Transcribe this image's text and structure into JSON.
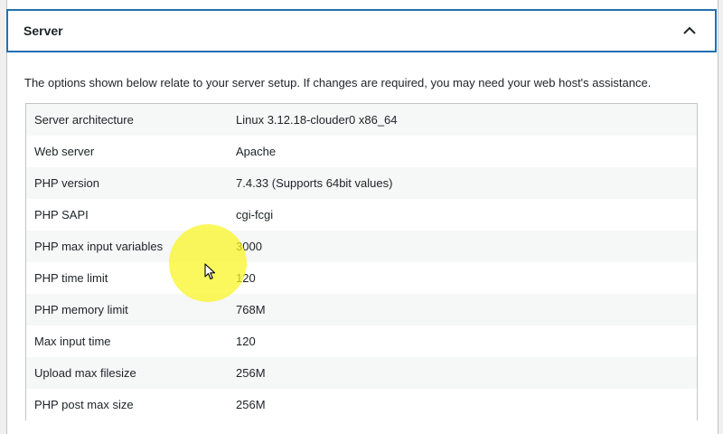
{
  "panel": {
    "title": "Server",
    "toggle_icon": "chevron-up-icon"
  },
  "intro_text": "The options shown below relate to your server setup. If changes are required, you may need your web host's assistance.",
  "rows": [
    {
      "label": "Server architecture",
      "value": "Linux 3.12.18-clouder0 x86_64"
    },
    {
      "label": "Web server",
      "value": "Apache"
    },
    {
      "label": "PHP version",
      "value": "7.4.33 (Supports 64bit values)"
    },
    {
      "label": "PHP SAPI",
      "value": "cgi-fcgi"
    },
    {
      "label": "PHP max input variables",
      "value": "3000"
    },
    {
      "label": "PHP time limit",
      "value": "120"
    },
    {
      "label": "PHP memory limit",
      "value": "768M"
    },
    {
      "label": "Max input time",
      "value": "120"
    },
    {
      "label": "Upload max filesize",
      "value": "256M"
    },
    {
      "label": "PHP post max size",
      "value": "256M"
    }
  ],
  "colors": {
    "accent": "#2271b1",
    "row_alt": "#f6f7f7",
    "cursor_highlight": "#faf51e"
  }
}
